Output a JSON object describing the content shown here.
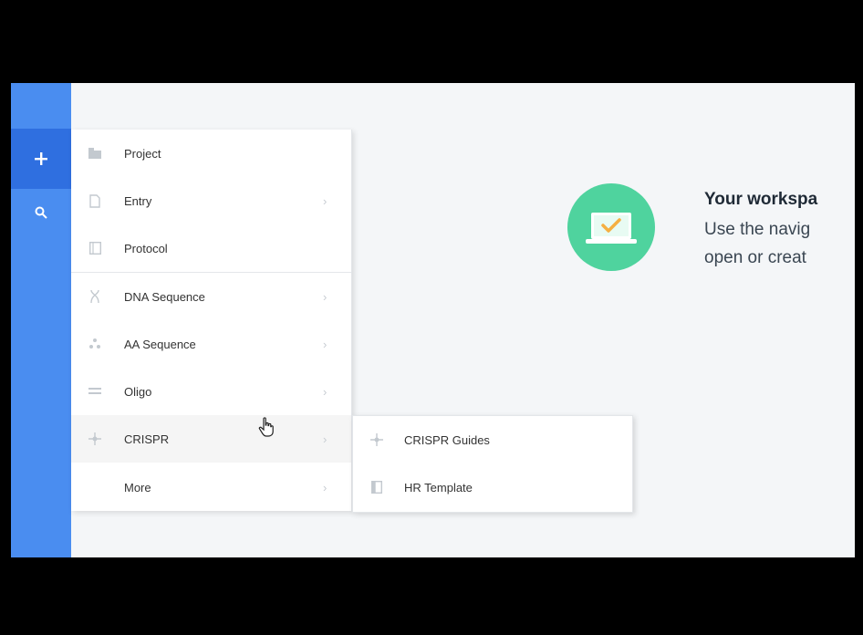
{
  "nav": {
    "add_icon": "plus-icon",
    "search_icon": "search-icon",
    "accent": "#4a8df0",
    "active_bg": "#2f6fe0"
  },
  "menu": {
    "items": [
      {
        "label": "Project",
        "icon": "folder-icon",
        "has_submenu": false
      },
      {
        "label": "Entry",
        "icon": "document-icon",
        "has_submenu": true
      },
      {
        "label": "Protocol",
        "icon": "protocol-icon",
        "has_submenu": false
      },
      {
        "label": "DNA Sequence",
        "icon": "dna-icon",
        "has_submenu": true
      },
      {
        "label": "AA Sequence",
        "icon": "aa-sequence-icon",
        "has_submenu": true
      },
      {
        "label": "Oligo",
        "icon": "oligo-icon",
        "has_submenu": true
      },
      {
        "label": "CRISPR",
        "icon": "crispr-icon",
        "has_submenu": true,
        "active": true
      },
      {
        "label": "More",
        "icon": "",
        "has_submenu": true
      }
    ],
    "chevron": "›"
  },
  "submenu": {
    "items": [
      {
        "label": "CRISPR Guides",
        "icon": "crispr-guides-icon"
      },
      {
        "label": "HR Template",
        "icon": "hr-template-icon"
      }
    ]
  },
  "empty_state": {
    "title": "Your workspa",
    "line1": "Use the navig",
    "line2": "open or creat",
    "icon": "laptop-check-icon",
    "icon_color": "#4fd39e"
  }
}
